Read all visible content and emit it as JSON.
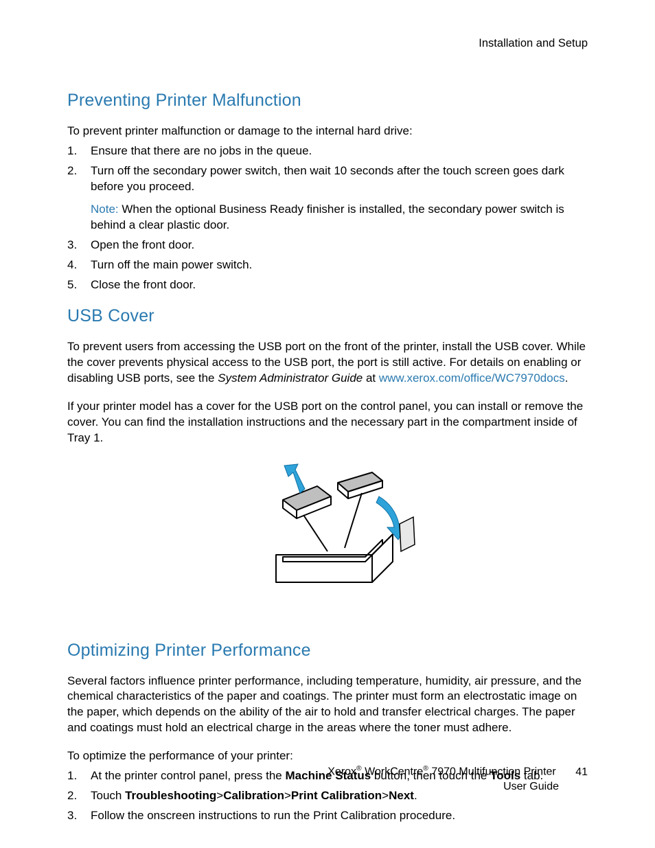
{
  "header": {
    "section": "Installation and Setup"
  },
  "s1": {
    "heading": "Preventing Printer Malfunction",
    "intro": "To prevent printer malfunction or damage to the internal hard drive:",
    "steps": {
      "n1": "1.",
      "t1": "Ensure that there are no jobs in the queue.",
      "n2": "2.",
      "t2": "Turn off the secondary power switch, then wait 10 seconds after the touch screen goes dark before you proceed.",
      "noteLabel": "Note:",
      "noteText": " When the optional Business Ready finisher is installed, the secondary power switch is behind a clear plastic door.",
      "n3": "3.",
      "t3": "Open the front door.",
      "n4": "4.",
      "t4": "Turn off the main power switch.",
      "n5": "5.",
      "t5": "Close the front door."
    }
  },
  "s2": {
    "heading": "USB Cover",
    "p1a": "To prevent users from accessing the USB port on the front of the printer, install the USB cover. While the cover prevents physical access to the USB port, the port is still active. For details on enabling or disabling USB ports, see the ",
    "p1b_italic": "System Administrator Guide",
    "p1c": " at ",
    "link": "www.xerox.com/office/WC7970docs",
    "p1d": ".",
    "p2": "If your printer model has a cover for the USB port on the control panel, you can install or remove the cover. You can find the installation instructions and the necessary part in the compartment inside of Tray 1."
  },
  "s3": {
    "heading": "Optimizing Printer Performance",
    "p1": "Several factors influence printer performance, including temperature, humidity, air pressure, and the chemical characteristics of the paper and coatings. The printer must form an electrostatic image on the paper, which depends on the ability of the air to hold and transfer electrical charges. The paper and coatings must hold an electrical charge in the areas where the toner must adhere.",
    "p2": "To optimize the performance of your printer:",
    "steps": {
      "n1": "1.",
      "t1a": "At the printer control panel, press the ",
      "t1b_bold": "Machine Status",
      "t1c": " button, then touch the ",
      "t1d_bold": "Tools",
      "t1e": " tab.",
      "n2": "2.",
      "t2a": "Touch ",
      "t2b_bold": "Troubleshooting",
      "t2c": ">",
      "t2d_bold": "Calibration",
      "t2e": ">",
      "t2f_bold": "Print Calibration",
      "t2g": ">",
      "t2h_bold": "Next",
      "t2i": ".",
      "n3": "3.",
      "t3": "Follow the onscreen instructions to run the Print Calibration procedure."
    }
  },
  "footer": {
    "line1a": "Xerox",
    "line1b": " WorkCentre",
    "line1c": " 7970 Multifunction Printer",
    "line2": "User Guide",
    "page": "41",
    "reg": "®"
  }
}
